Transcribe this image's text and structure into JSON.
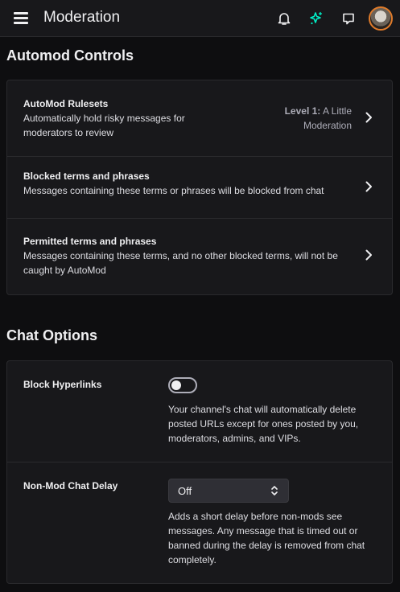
{
  "header": {
    "title": "Moderation",
    "icons": [
      "menu-icon",
      "bell-icon",
      "sparkle-icon",
      "whisper-icon",
      "avatar"
    ],
    "accent_color": "#00f0c8"
  },
  "automod": {
    "section_title": "Automod Controls",
    "rows": [
      {
        "title": "AutoMod Rulesets",
        "desc_lines": [
          "Automatically hold risky messages for",
          "moderators to review"
        ],
        "level_bold": "Level 1:",
        "level_rest": " A Little",
        "level_line2": "Moderation"
      },
      {
        "title": "Blocked terms and phrases",
        "desc_lines": [
          "Messages containing these terms or phrases will be blocked from chat"
        ]
      },
      {
        "title": "Permitted terms and phrases",
        "desc_lines": [
          "Messages containing these terms, and no other blocked terms, will not be",
          "caught by AutoMod"
        ]
      }
    ]
  },
  "chat_options": {
    "section_title": "Chat Options",
    "block_hyperlinks": {
      "label": "Block Hyperlinks",
      "enabled": false,
      "desc_lines": [
        "Your channel's chat will automatically delete",
        "posted URLs except for ones posted by you,",
        "moderators, admins, and VIPs."
      ]
    },
    "chat_delay": {
      "label": "Non-Mod Chat Delay",
      "selected": "Off",
      "desc_lines": [
        "Adds a short delay before non-mods see",
        "messages. Any message that is timed out or",
        "banned during the delay is removed from chat",
        "completely."
      ]
    }
  }
}
